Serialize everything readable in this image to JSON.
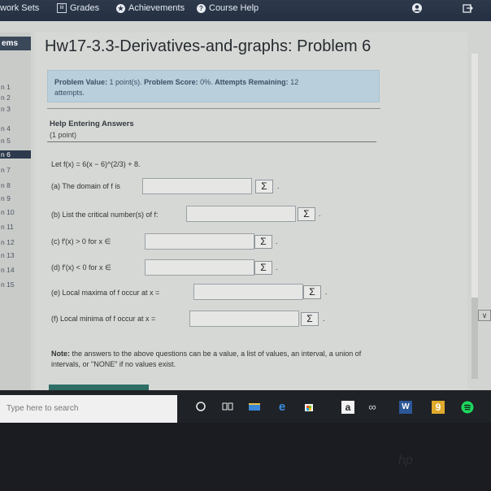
{
  "topnav": {
    "items": [
      "work Sets",
      "Grades",
      "Achievements",
      "Course Help"
    ],
    "grades_icon": "iii"
  },
  "sidebar": {
    "heading": "ems",
    "items": [
      "n 1",
      "n 2",
      "n 3",
      "n 4",
      "n 5",
      "n 6",
      "n 7",
      "n 8",
      "n 9",
      "n 10",
      "n 11",
      "n 12",
      "n 13",
      "n 14",
      "n 15"
    ],
    "active_index": 5
  },
  "problem": {
    "title": "Hw17-3.3-Derivatives-and-graphs: Problem 6",
    "value_label": "Problem Value:",
    "value_text": "1 point(s).",
    "score_label": "Problem Score:",
    "score_text": "0%.",
    "attempts_label": "Attempts Remaining:",
    "attempts_text": "12",
    "attempts_suffix": "attempts.",
    "help_title": "Help Entering Answers",
    "points": "(1 point)",
    "statement": "Let f(x) = 6(x − 6)^(2/3) + 8.",
    "questions": [
      "(a) The domain of f is",
      "(b) List the critical number(s) of f:",
      "(c) f′(x) > 0 for x ∈",
      "(d) f′(x) < 0 for x ∈",
      "(e) Local maxima of f occur at x =",
      "(f) Local minima of f occur at x ="
    ],
    "sigma": "Σ",
    "period": ".",
    "note_label": "Note:",
    "note_text": "the answers to the above questions can be a value, a list of values, an interval, a union of intervals, or \"NONE\" if no values exist."
  },
  "taskbar": {
    "search_placeholder": "Type here to search",
    "icons": [
      "cortana-icon",
      "task-view-icon",
      "file-explorer-icon",
      "edge-icon",
      "store-icon",
      "amazon-icon",
      "link-icon",
      "word-icon",
      "chrome-icon",
      "spotify-icon"
    ],
    "amazon_letter": "a",
    "word_letter": "W",
    "chrome_letter": "9"
  }
}
